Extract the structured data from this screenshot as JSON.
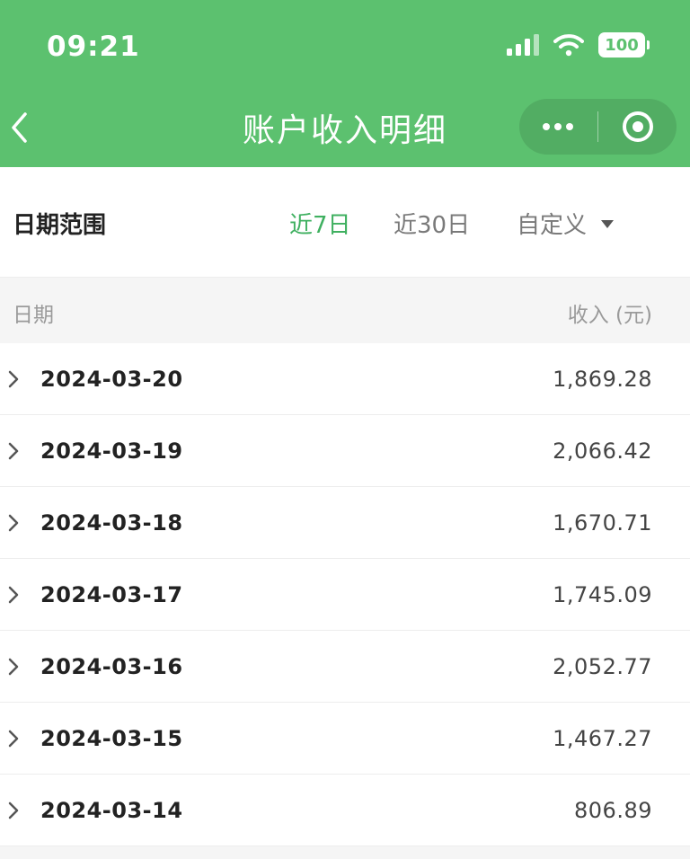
{
  "status_bar": {
    "time": "09:21",
    "battery": "100"
  },
  "nav": {
    "title": "账户收入明细"
  },
  "filter": {
    "label": "日期范围",
    "options": [
      "近7日",
      "近30日",
      "自定义"
    ],
    "selected": "近7日"
  },
  "table": {
    "columns": [
      "日期",
      "收入 (元)"
    ],
    "rows": [
      {
        "date": "2024-03-20",
        "amount": "1,869.28"
      },
      {
        "date": "2024-03-19",
        "amount": "2,066.42"
      },
      {
        "date": "2024-03-18",
        "amount": "1,670.71"
      },
      {
        "date": "2024-03-17",
        "amount": "1,745.09"
      },
      {
        "date": "2024-03-16",
        "amount": "2,052.77"
      },
      {
        "date": "2024-03-15",
        "amount": "1,467.27"
      },
      {
        "date": "2024-03-14",
        "amount": "806.89"
      }
    ]
  },
  "colors": {
    "header": "#5cc16f",
    "accent": "#3fb060"
  }
}
